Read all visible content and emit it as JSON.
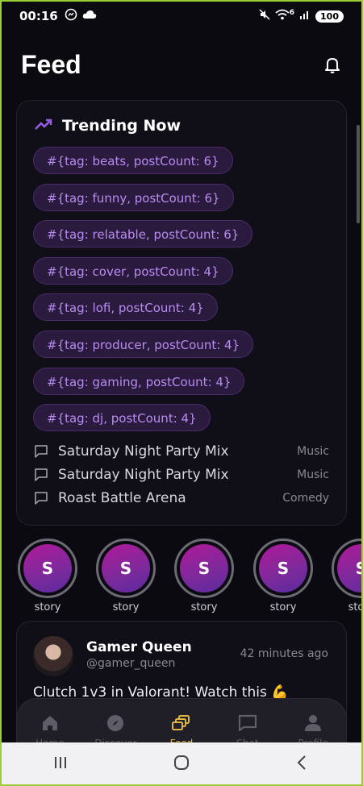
{
  "status_bar": {
    "time": "00:16",
    "battery": "100",
    "signal_text": "6"
  },
  "header": {
    "title": "Feed"
  },
  "trending": {
    "title": "Trending Now",
    "chips": [
      "#{tag: beats, postCount: 6}",
      "#{tag: funny, postCount: 6}",
      "#{tag: relatable, postCount: 6}",
      "#{tag: cover, postCount: 4}",
      "#{tag: lofi, postCount: 4}",
      "#{tag: producer, postCount: 4}",
      "#{tag: gaming, postCount: 4}",
      "#{tag: dj, postCount: 4}"
    ],
    "rooms": [
      {
        "name": "Saturday Night Party Mix",
        "category": "Music"
      },
      {
        "name": "Saturday Night Party Mix",
        "category": "Music"
      },
      {
        "name": "Roast Battle Arena",
        "category": "Comedy"
      }
    ]
  },
  "stories": [
    {
      "initial": "S",
      "label": "story"
    },
    {
      "initial": "S",
      "label": "story"
    },
    {
      "initial": "S",
      "label": "story"
    },
    {
      "initial": "S",
      "label": "story"
    },
    {
      "initial": "S",
      "label": "story"
    }
  ],
  "post": {
    "author": "Gamer Queen",
    "handle": "@gamer_queen",
    "time": "42 minutes ago",
    "text": "Clutch 1v3 in Valorant! Watch this 💪"
  },
  "bottom_nav": {
    "items": [
      {
        "label": "Home",
        "icon": "home-icon"
      },
      {
        "label": "Discover",
        "icon": "compass-icon"
      },
      {
        "label": "Feed",
        "icon": "feed-icon",
        "active": true
      },
      {
        "label": "Chat",
        "icon": "chat-icon"
      },
      {
        "label": "Profile",
        "icon": "profile-icon"
      }
    ]
  },
  "colors": {
    "background": "#0b0a10",
    "chip_bg": "#2a1a3e",
    "chip_text": "#b98cf0",
    "accent_active": "#e0b63f"
  }
}
